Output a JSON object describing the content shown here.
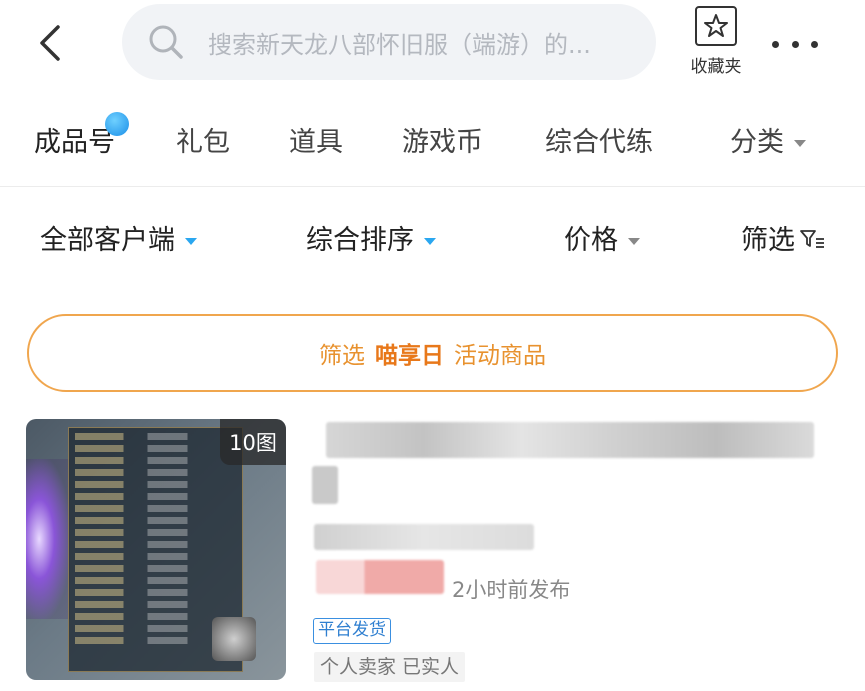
{
  "search": {
    "placeholder": "搜索新天龙八部怀旧服（端游）的..."
  },
  "header": {
    "favorites_label": "收藏夹"
  },
  "category_tabs": [
    {
      "label": "成品号",
      "active": true,
      "has_dot": true
    },
    {
      "label": "礼包"
    },
    {
      "label": "道具"
    },
    {
      "label": "游戏币"
    },
    {
      "label": "综合代练"
    },
    {
      "label": "分类",
      "has_caret": true
    }
  ],
  "filters": {
    "client": "全部客户端",
    "sort": "综合排序",
    "price": "价格",
    "screen": "筛选"
  },
  "banner": {
    "prefix": "筛选",
    "highlight": "喵享日",
    "suffix": "活动商品"
  },
  "listing": {
    "image_count": "10图",
    "posted": "2小时前发布",
    "tag_platform": "平台发货",
    "seller_info": "个人卖家  已实人"
  },
  "colors": {
    "accent_blue": "#2aa7f0",
    "banner_orange": "#f0a64e",
    "tag_blue": "#3a8fe0"
  },
  "icons": [
    "back-arrow-icon",
    "search-icon",
    "star-favorites-icon",
    "more-dots-icon",
    "filter-funnel-icon",
    "caret-down-icon"
  ]
}
